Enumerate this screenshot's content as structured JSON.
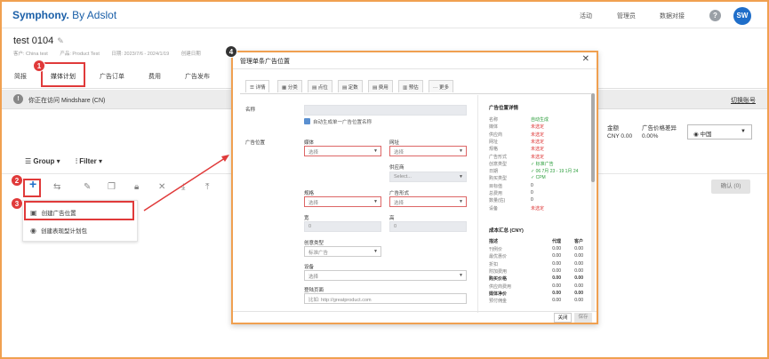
{
  "header": {
    "logo_brand": "Symphony.",
    "logo_rest": " By Adslot",
    "nav": [
      "活动",
      "管理员",
      "数据对接"
    ],
    "help": "?",
    "avatar": "SW"
  },
  "page": {
    "title": "test 0104",
    "meta": [
      "客户: China test",
      "产品: Product Test",
      "日期: 2023/7/6 - 2024/1/19",
      "创建日期"
    ],
    "tabs": [
      "简报",
      "媒体计划",
      "广告订单",
      "费用",
      "广告发布"
    ]
  },
  "notice": {
    "text": "你正在访问 Mindshare (CN)",
    "switch": "切换账号"
  },
  "budget": {
    "label1": "金额",
    "value1": "CNY 0.00",
    "label2": "广告价格差异",
    "value2": "0.00%",
    "country": "中国"
  },
  "toolbar": {
    "group": "Group",
    "filter": "Filter",
    "confirm": "确认 (0)"
  },
  "dropdown": {
    "items": [
      "创建广告位置",
      "创建表现型计划包"
    ]
  },
  "badges": [
    "1",
    "2",
    "3",
    "4"
  ],
  "modal": {
    "title": "管理单条广告位置",
    "close": "✕",
    "tabs": [
      "详情",
      "分类",
      "点位",
      "定数",
      "费用",
      "预估",
      "更多"
    ],
    "fields": {
      "name": "名称",
      "autogen": "自动生成单一广告位置名称",
      "placement": "广告位置",
      "media": "媒体",
      "site": "网址",
      "select": "选择",
      "supplier": "供应商",
      "supplier_ph": "Select...",
      "spec": "规格",
      "adformat": "广告形式",
      "width": "宽",
      "height": "高",
      "zero": "0",
      "creative_type": "创意类型",
      "creative_val": "标准广告",
      "device": "设备",
      "landing": "登陆页面",
      "landing_ph": "比如: http://greatproduct.com"
    },
    "summary": {
      "title": "广告位置详情",
      "rows": [
        {
          "k": "名称",
          "v": "自动生成",
          "s": "ok"
        },
        {
          "k": "媒体",
          "v": "未选定",
          "s": "bad"
        },
        {
          "k": "供应商",
          "v": "未选定",
          "s": "bad"
        },
        {
          "k": "网址",
          "v": "未选定",
          "s": "bad"
        },
        {
          "k": "规格",
          "v": "未选定",
          "s": "bad"
        },
        {
          "k": "广告形式",
          "v": "未选定",
          "s": "bad"
        },
        {
          "k": "创意类型",
          "v": "✓ 标准广告",
          "s": "ok"
        },
        {
          "k": "日期",
          "v": "✓ 06 7月 23 - 19 1月 24",
          "s": "ok"
        },
        {
          "k": "购买类型",
          "v": "✓ CPM",
          "s": "ok"
        },
        {
          "k": "目标值",
          "v": "0",
          "s": "dk"
        },
        {
          "k": "总费用",
          "v": "0",
          "s": "dk"
        },
        {
          "k": "数量(估)",
          "v": "0",
          "s": "dk"
        },
        {
          "k": "设备",
          "v": "未选定",
          "s": "bad"
        }
      ],
      "cost_title": "成本汇总 (CNY)",
      "cost_header": [
        "描述",
        "代理",
        "客户"
      ],
      "cost_rows": [
        {
          "k": "刊例价",
          "a": "0.00",
          "b": "0.00",
          "bold": false
        },
        {
          "k": "最优惠价",
          "a": "0.00",
          "b": "0.00",
          "bold": false
        },
        {
          "k": "折扣",
          "a": "0.00",
          "b": "0.00",
          "bold": false
        },
        {
          "k": "附加费用",
          "a": "0.00",
          "b": "0.00",
          "bold": false
        },
        {
          "k": "购买价格",
          "a": "0.00",
          "b": "0.00",
          "bold": true
        },
        {
          "k": "供应商费用",
          "a": "0.00",
          "b": "0.00",
          "bold": false
        },
        {
          "k": "媒体净价",
          "a": "0.00",
          "b": "0.00",
          "bold": true
        },
        {
          "k": "预付佣金",
          "a": "0.00",
          "b": "0.00",
          "bold": false
        }
      ]
    },
    "footer": {
      "close": "关闭",
      "save": "保存"
    }
  },
  "colors": {
    "accent": "#1f6ec9",
    "highlight": "#e03a3a",
    "frame": "#f0a050"
  }
}
